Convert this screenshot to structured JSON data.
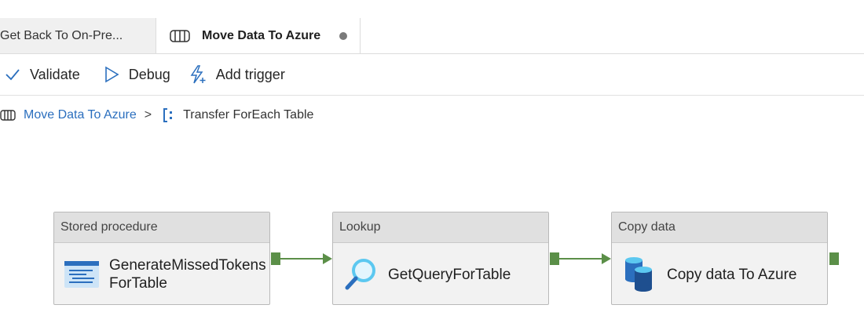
{
  "tabs": [
    {
      "label": "Get Back To On-Pre...",
      "active": false
    },
    {
      "label": "Move Data To Azure",
      "active": true,
      "unsaved": true
    }
  ],
  "toolbar": {
    "validate_label": "Validate",
    "debug_label": "Debug",
    "add_trigger_label": "Add trigger"
  },
  "breadcrumb": {
    "parent": "Move Data To Azure",
    "separator": ">",
    "current": "Transfer ForEach Table"
  },
  "activities": [
    {
      "type": "Stored procedure",
      "name_line1": "GenerateMissedTokens",
      "name_line2": "ForTable",
      "icon": "stored-procedure-icon"
    },
    {
      "type": "Lookup",
      "name": "GetQueryForTable",
      "icon": "magnifier-icon"
    },
    {
      "type": "Copy data",
      "name": "Copy data To Azure",
      "icon": "database-icon"
    }
  ],
  "colors": {
    "success_connector": "#5b8f48",
    "link": "#2b6fbe",
    "accent_icon": "#2b6fbe"
  }
}
